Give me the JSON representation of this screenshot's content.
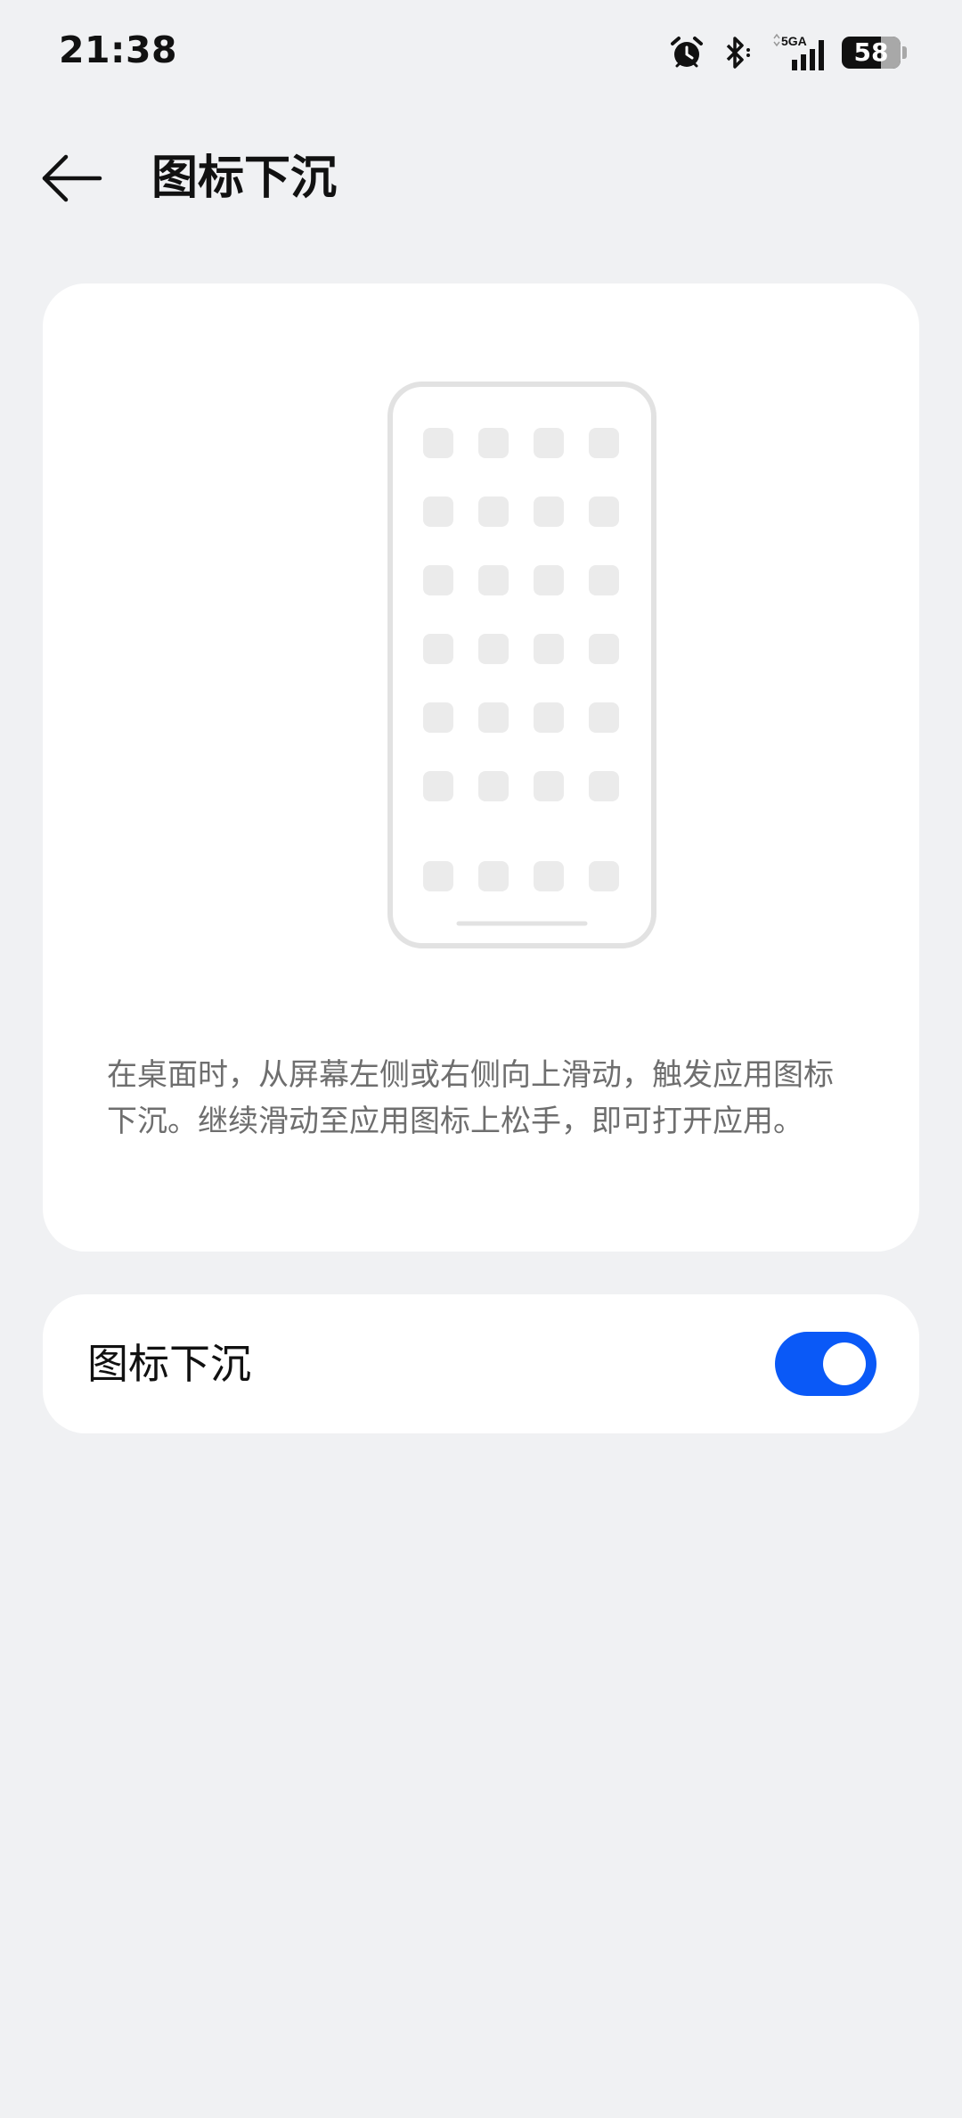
{
  "status_bar": {
    "time": "21:38",
    "network": "5GA",
    "battery_level": "58",
    "icons": [
      "alarm-icon",
      "bluetooth-icon",
      "cellular-signal-icon",
      "battery-icon"
    ]
  },
  "header": {
    "back_icon": "back-arrow-icon",
    "title": "图标下沉"
  },
  "illustration_card": {
    "illustration": "phone-home-screen-grid",
    "icon_rows": 6,
    "icon_columns": 4,
    "dock_icons": 4,
    "description": "在桌面时，从屏幕左侧或右侧向上滑动，触发应用图标下沉。继续滑动至应用图标上松手，即可打开应用。"
  },
  "settings": {
    "icon_sink_label": "图标下沉",
    "icon_sink_enabled": true
  },
  "colors": {
    "background": "#f0f1f3",
    "card": "#ffffff",
    "accent": "#0a59f7",
    "illustration_stroke": "#e2e2e2"
  }
}
